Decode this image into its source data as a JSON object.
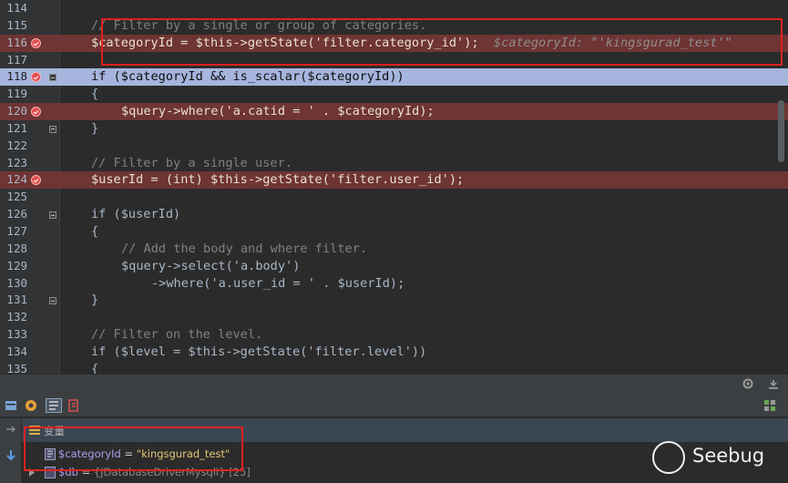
{
  "editor": {
    "lines": [
      {
        "num": "114",
        "type": "normal",
        "tokens": []
      },
      {
        "num": "115",
        "type": "normal",
        "tokens": [
          {
            "t": "// Filter by a single or group of categories.",
            "c": "c-comment",
            "indent": 1
          }
        ]
      },
      {
        "num": "116",
        "type": "breakpoint",
        "tokens": [
          {
            "t": "$categoryId = $this->getState('filter.category_id');",
            "c": "",
            "indent": 1
          },
          {
            "t": "  $categoryId: \"'kingsgurad_test'\"",
            "c": "c-inline"
          }
        ]
      },
      {
        "num": "117",
        "type": "normal",
        "tokens": []
      },
      {
        "num": "118",
        "type": "current",
        "tokens": [
          {
            "t": "if ($categoryId && is_scalar($categoryId))",
            "c": "",
            "indent": 1
          }
        ]
      },
      {
        "num": "119",
        "type": "normal",
        "tokens": [
          {
            "t": "{",
            "c": "",
            "indent": 1
          }
        ]
      },
      {
        "num": "120",
        "type": "breakpoint",
        "tokens": [
          {
            "t": "$query->where('a.catid = ' . $categoryId);",
            "c": "",
            "indent": 2
          }
        ]
      },
      {
        "num": "121",
        "type": "normal",
        "tokens": [
          {
            "t": "}",
            "c": "",
            "indent": 1
          }
        ]
      },
      {
        "num": "122",
        "type": "normal",
        "tokens": []
      },
      {
        "num": "123",
        "type": "normal",
        "tokens": [
          {
            "t": "// Filter by a single user.",
            "c": "c-comment",
            "indent": 1
          }
        ]
      },
      {
        "num": "124",
        "type": "breakpoint",
        "tokens": [
          {
            "t": "$userId = (int) $this->getState('filter.user_id');",
            "c": "",
            "indent": 1
          }
        ]
      },
      {
        "num": "125",
        "type": "normal",
        "tokens": []
      },
      {
        "num": "126",
        "type": "normal",
        "tokens": [
          {
            "t": "if ($userId)",
            "c": "",
            "indent": 1
          }
        ]
      },
      {
        "num": "127",
        "type": "normal",
        "tokens": [
          {
            "t": "{",
            "c": "",
            "indent": 1
          }
        ]
      },
      {
        "num": "128",
        "type": "normal",
        "tokens": [
          {
            "t": "// Add the body and where filter.",
            "c": "c-comment",
            "indent": 2
          }
        ]
      },
      {
        "num": "129",
        "type": "normal",
        "tokens": [
          {
            "t": "$query->select('a.body')",
            "c": "",
            "indent": 2
          }
        ]
      },
      {
        "num": "130",
        "type": "normal",
        "tokens": [
          {
            "t": "->where('a.user_id = ' . $userId);",
            "c": "",
            "indent": 3
          }
        ]
      },
      {
        "num": "131",
        "type": "normal",
        "tokens": [
          {
            "t": "}",
            "c": "",
            "indent": 1
          }
        ]
      },
      {
        "num": "132",
        "type": "normal",
        "tokens": []
      },
      {
        "num": "133",
        "type": "normal",
        "tokens": [
          {
            "t": "// Filter on the level.",
            "c": "c-comment",
            "indent": 1
          }
        ]
      },
      {
        "num": "134",
        "type": "normal",
        "tokens": [
          {
            "t": "if ($level = $this->getState('filter.level'))",
            "c": "",
            "indent": 1
          }
        ]
      },
      {
        "num": "135",
        "type": "normal",
        "tokens": [
          {
            "t": "{",
            "c": "",
            "indent": 1
          }
        ]
      }
    ],
    "fold_lines": [
      "118",
      "121",
      "126",
      "131"
    ]
  },
  "debugger": {
    "variables_header": "变量",
    "variables": [
      {
        "name": "$categoryId",
        "eq": " = ",
        "value": "\"kingsgurad_test\""
      },
      {
        "name": "$db",
        "eq": " = ",
        "value": "{JDatabaseDriverMysqli} [25]"
      }
    ]
  },
  "watermark": {
    "text": "Seebug"
  },
  "colors": {
    "breakpoint_line": "#6f3434",
    "current_line": "#a5b5dd",
    "highlight_box": "#e02020"
  }
}
